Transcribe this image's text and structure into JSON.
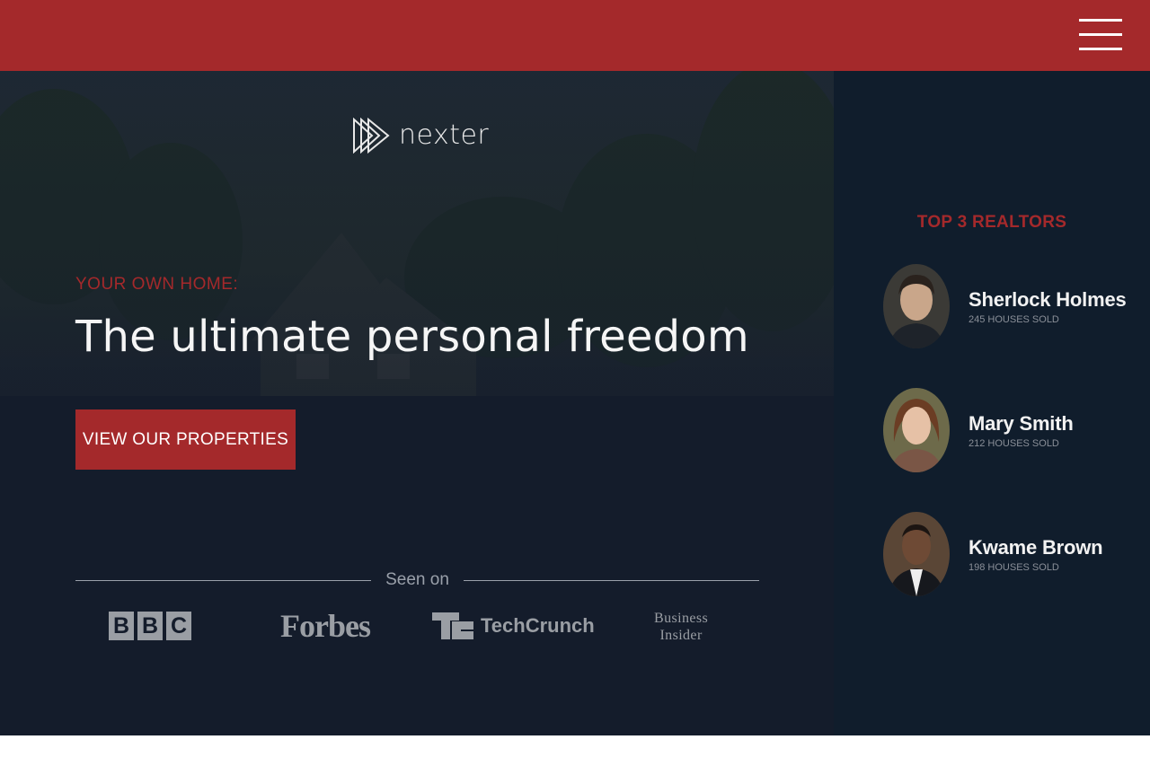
{
  "header": {
    "menu_icon": "hamburger-menu-icon",
    "accent_color": "#a4292b"
  },
  "hero": {
    "logo_text": "nexter",
    "eyebrow": "YOUR OWN HOME:",
    "headline": "The ultimate personal freedom",
    "cta_label": "VIEW OUR PROPERTIES",
    "seen_on_label": "Seen on",
    "press": [
      {
        "name": "BBC",
        "letters": [
          "B",
          "B",
          "C"
        ]
      },
      {
        "name": "Forbes"
      },
      {
        "name": "TechCrunch"
      },
      {
        "name": "Business Insider",
        "lines": [
          "Business",
          "Insider"
        ]
      }
    ]
  },
  "sidebar": {
    "title": "TOP 3 REALTORS",
    "realtors": [
      {
        "name": "Sherlock Holmes",
        "sold": "245 HOUSES SOLD"
      },
      {
        "name": "Mary Smith",
        "sold": "212 HOUSES SOLD"
      },
      {
        "name": "Kwame Brown",
        "sold": "198 HOUSES SOLD"
      }
    ]
  }
}
